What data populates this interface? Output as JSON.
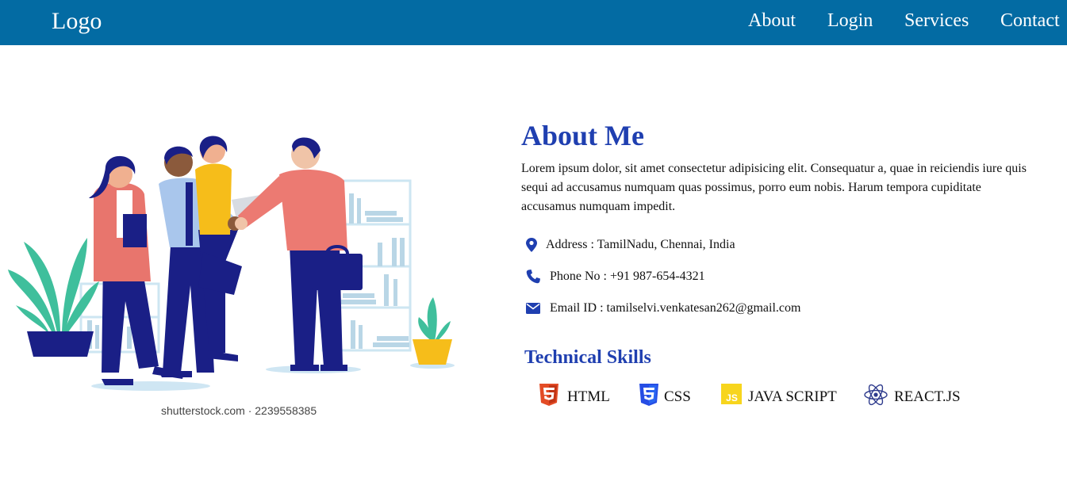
{
  "navbar": {
    "logo": "Logo",
    "links": [
      "About",
      "Login",
      "Services",
      "Contact"
    ],
    "background": "#036ba3"
  },
  "hero": {
    "credit": "shutterstock.com · 2239558385"
  },
  "about": {
    "title": "About Me",
    "text": "Lorem ipsum dolor, sit amet consectetur adipisicing elit. Consequatur a, quae in reiciendis iure quis sequi ad accusamus numquam quas possimus, porro eum nobis. Harum tempora cupiditate accusamus numquam impedit.",
    "accent": "#1f3fb0",
    "info": [
      {
        "icon": "map-pin-icon",
        "text": "Address : TamilNadu, Chennai, India"
      },
      {
        "icon": "phone-icon",
        "text": "Phone No : +91 987-654-4321"
      },
      {
        "icon": "envelope-icon",
        "text": "Email ID : tamilselvi.venkatesan262@gmail.com"
      }
    ]
  },
  "skills": {
    "title": "Technical Skills",
    "items": [
      {
        "icon": "html5-icon",
        "label": "HTML"
      },
      {
        "icon": "css3-icon",
        "label": "CSS"
      },
      {
        "icon": "javascript-icon",
        "label": "JAVA SCRIPT"
      },
      {
        "icon": "react-icon",
        "label": "REACT.JS"
      }
    ]
  }
}
